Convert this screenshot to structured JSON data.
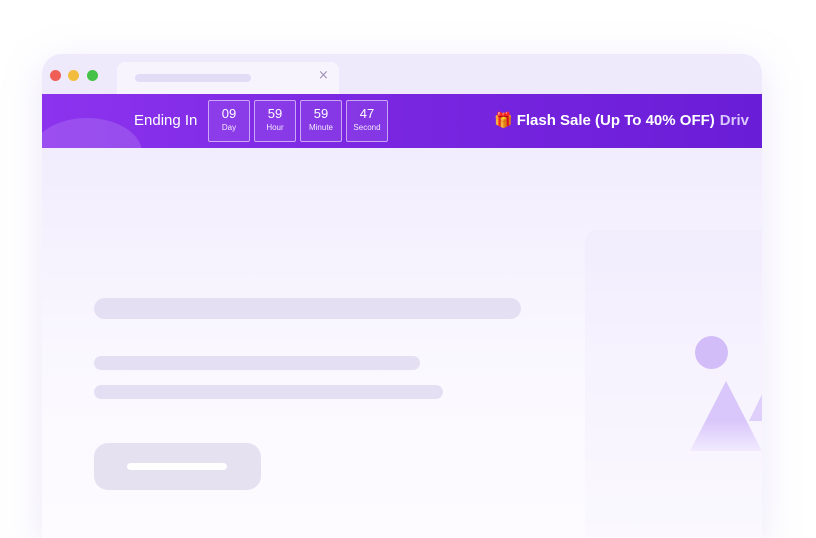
{
  "browser": {
    "tab_close_icon": "×"
  },
  "banner": {
    "ending_label": "Ending In",
    "countdown": [
      {
        "value": "09",
        "unit": "Day"
      },
      {
        "value": "59",
        "unit": "Hour"
      },
      {
        "value": "59",
        "unit": "Minute"
      },
      {
        "value": "47",
        "unit": "Second"
      }
    ],
    "gift_icon": "🎁",
    "sale_text": "Flash Sale (Up To 40% OFF)",
    "sale_trailing": "Driv"
  },
  "colors": {
    "banner_start": "#8c33ee",
    "banner_end": "#6a1dd6",
    "skeleton": "#e5dff3"
  }
}
